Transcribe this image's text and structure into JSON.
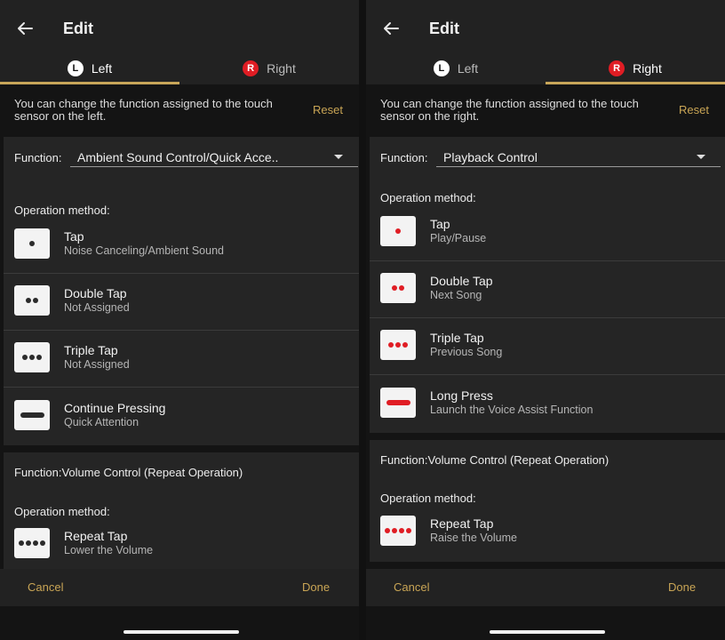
{
  "header": {
    "title": "Edit"
  },
  "tabs": [
    {
      "badge": "L",
      "label": "Left"
    },
    {
      "badge": "R",
      "label": "Right"
    }
  ],
  "reset_label": "Reset",
  "bottom": {
    "cancel": "Cancel",
    "done": "Done"
  },
  "left": {
    "description": "You can change the function assigned to the touch sensor on the left.",
    "function_label": "Function:",
    "function_value": "Ambient Sound Control/Quick Acce..",
    "operation_label": "Operation method:",
    "operations": [
      {
        "title": "Tap",
        "subtitle": "Noise Canceling/Ambient Sound",
        "icon": "single-dot-icon"
      },
      {
        "title": "Double Tap",
        "subtitle": "Not Assigned",
        "icon": "double-dot-icon"
      },
      {
        "title": "Triple Tap",
        "subtitle": "Not Assigned",
        "icon": "triple-dot-icon"
      },
      {
        "title": "Continue Pressing",
        "subtitle": "Quick Attention",
        "icon": "long-bar-icon"
      }
    ],
    "volume_function": "Function:Volume Control (Repeat Operation)",
    "volume_operation_label": "Operation method:",
    "volume_operation": {
      "title": "Repeat Tap",
      "subtitle": "Lower the Volume",
      "icon": "quad-dot-icon"
    },
    "icon_color": "#2b2b2b"
  },
  "right": {
    "description": "You can change the function assigned to the touch sensor on the right.",
    "function_label": "Function:",
    "function_value": "Playback Control",
    "operation_label": "Operation method:",
    "operations": [
      {
        "title": "Tap",
        "subtitle": "Play/Pause",
        "icon": "single-dot-icon"
      },
      {
        "title": "Double Tap",
        "subtitle": "Next Song",
        "icon": "double-dot-icon"
      },
      {
        "title": "Triple Tap",
        "subtitle": "Previous Song",
        "icon": "triple-dot-icon"
      },
      {
        "title": "Long Press",
        "subtitle": "Launch the Voice Assist Function",
        "icon": "long-bar-icon"
      }
    ],
    "volume_function": "Function:Volume Control (Repeat Operation)",
    "volume_operation_label": "Operation method:",
    "volume_operation": {
      "title": "Repeat Tap",
      "subtitle": "Raise the Volume",
      "icon": "quad-dot-icon"
    },
    "icon_color": "#e01d24"
  },
  "colors": {
    "accent": "#c8a659",
    "right_badge": "#e01d24",
    "panel": "#252525",
    "bar": "#222222"
  }
}
